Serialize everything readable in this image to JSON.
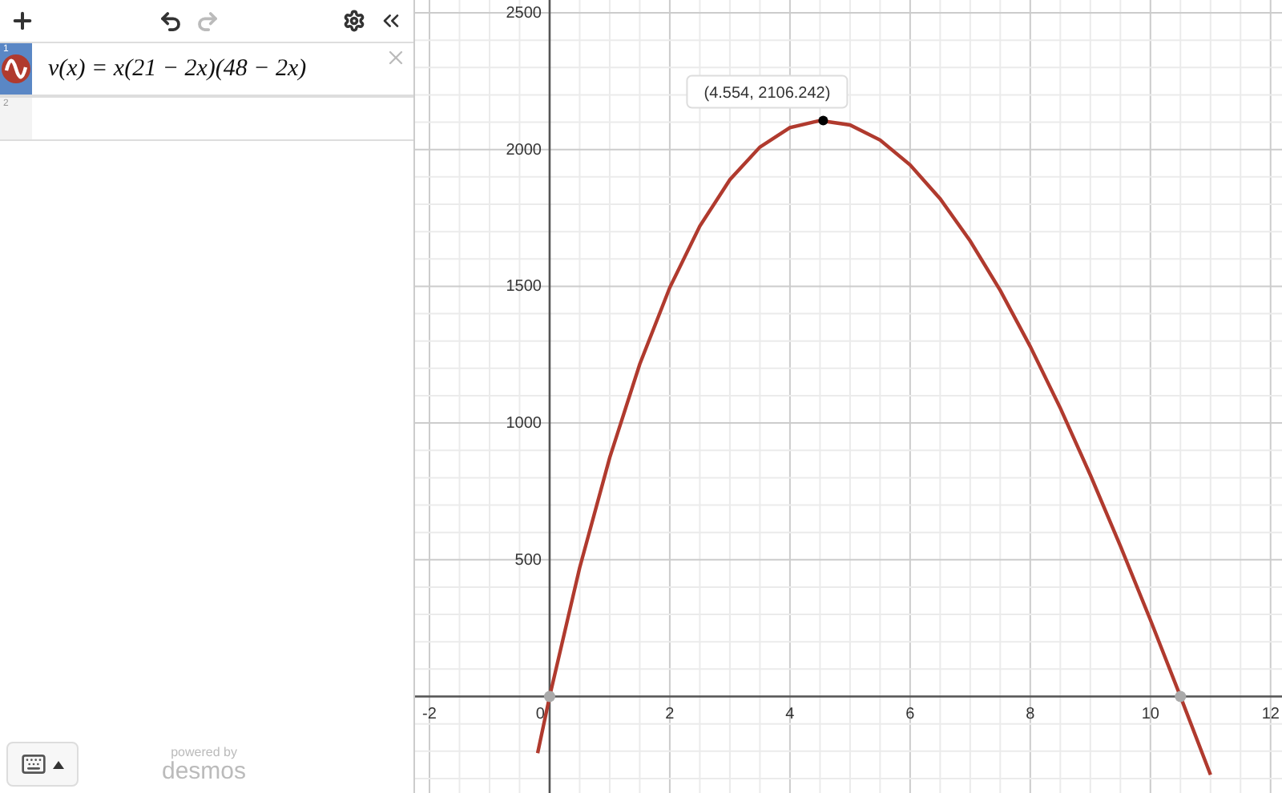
{
  "expressions": [
    {
      "index": "1",
      "formula": "v(x) = x(21 − 2x)(48 − 2x)",
      "color": "#b03a2e",
      "selected": true
    },
    {
      "index": "2",
      "selected": false
    }
  ],
  "branding": {
    "powered_by": "powered by",
    "name": "desmos"
  },
  "graph": {
    "chart_data": {
      "type": "line",
      "grid": true,
      "x": [
        -0.2,
        0,
        0.5,
        1,
        1.5,
        2,
        2.5,
        3,
        3.5,
        4,
        4.5,
        5,
        5.5,
        6,
        6.5,
        7,
        7.5,
        8,
        8.5,
        9,
        9.5,
        10,
        10.5,
        11
      ],
      "series": [
        {
          "color": "#b03a2e",
          "values": [
            -207,
            0,
            470,
            874,
            1215,
            1496,
            1720,
            1890,
            2009,
            2080,
            2106,
            2090,
            2035,
            1944,
            1820,
            1666,
            1485,
            1280,
            1054,
            810,
            551,
            280,
            0,
            -286
          ]
        }
      ],
      "xlim": [
        -2.24,
        12.19
      ],
      "ylim": [
        -353,
        2547
      ],
      "xticks": [
        -2,
        0,
        2,
        4,
        6,
        8,
        10,
        12
      ],
      "yticks": [
        500,
        1000,
        1500,
        2000,
        2500
      ],
      "annotations": [
        {
          "x": 4.554,
          "y": 2106.242,
          "text": "(4.554, 2106.242)"
        }
      ]
    }
  }
}
